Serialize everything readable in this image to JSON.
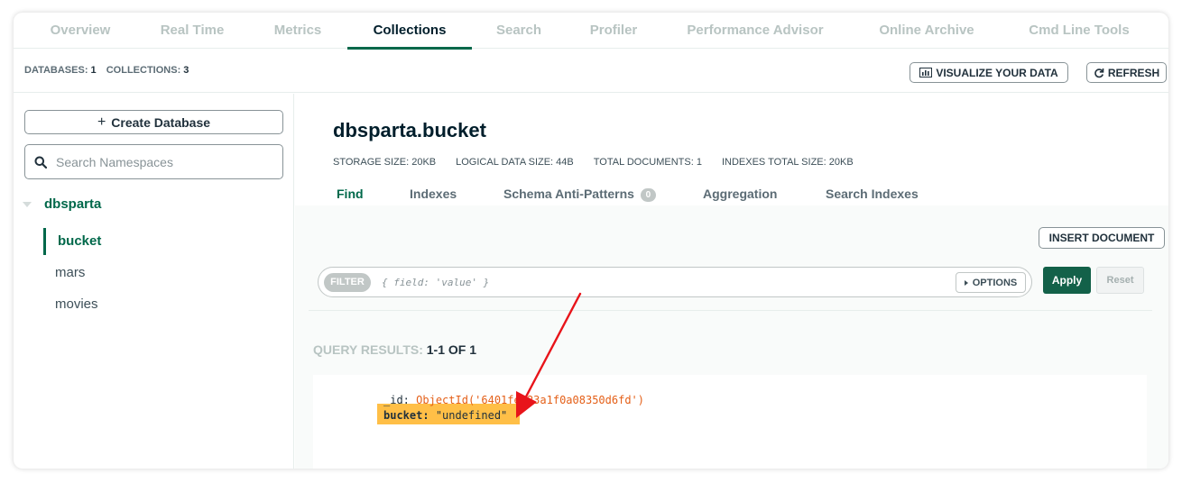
{
  "tabs": [
    {
      "label": "Overview"
    },
    {
      "label": "Real Time"
    },
    {
      "label": "Metrics"
    },
    {
      "label": "Collections",
      "active": true
    },
    {
      "label": "Search"
    },
    {
      "label": "Profiler"
    },
    {
      "label": "Performance Advisor"
    },
    {
      "label": "Online Archive"
    },
    {
      "label": "Cmd Line Tools"
    }
  ],
  "summary": {
    "databases_label": "DATABASES:",
    "databases_count": "1",
    "collections_label": "COLLECTIONS:",
    "collections_count": "3",
    "visualize_label": "VISUALIZE YOUR DATA",
    "refresh_label": "REFRESH"
  },
  "sidebar": {
    "create_db_label": "Create Database",
    "search_placeholder": "Search Namespaces",
    "database": "dbsparta",
    "collections": [
      "bucket",
      "mars",
      "movies"
    ]
  },
  "main": {
    "title": "dbsparta.bucket",
    "stats": [
      "STORAGE SIZE: 20KB",
      "LOGICAL DATA SIZE: 44B",
      "TOTAL DOCUMENTS: 1",
      "INDEXES TOTAL SIZE: 20KB"
    ],
    "subtabs": [
      {
        "label": "Find",
        "active": true
      },
      {
        "label": "Indexes"
      },
      {
        "label": "Schema Anti-Patterns",
        "badge": "0"
      },
      {
        "label": "Aggregation"
      },
      {
        "label": "Search Indexes"
      }
    ],
    "insert_label": "INSERT DOCUMENT",
    "filter": {
      "pill": "FILTER",
      "placeholder": "{ field: 'value' }",
      "options_label": "OPTIONS",
      "apply_label": "Apply",
      "reset_label": "Reset"
    },
    "query_results_label": "QUERY RESULTS:",
    "query_results_value": "1-1 OF 1",
    "document": {
      "id_key": "_id:",
      "id_value": "ObjectId('6401fea23a1f0a08350d6fd')",
      "bucket_key": "bucket:",
      "bucket_value": "\"undefined\""
    }
  },
  "colors": {
    "accent": "#00684a",
    "highlight": "#ffa600",
    "arrow": "#e8141a"
  },
  "icons": [
    "plus-icon",
    "search-icon",
    "chart-icon",
    "refresh-icon",
    "caret-down-icon",
    "caret-right-icon",
    "arrow-annotation"
  ]
}
